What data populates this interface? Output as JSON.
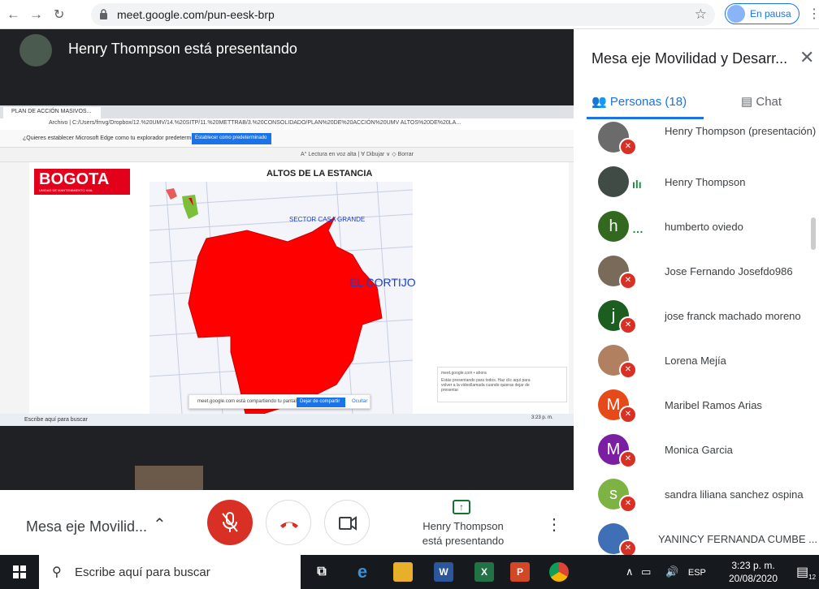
{
  "browser": {
    "url": "meet.google.com/pun-eesk-brp",
    "pause_label": "En pausa"
  },
  "stage": {
    "presenting_title": "Henry Thompson está presentando"
  },
  "screen": {
    "tab_label": "PLAN DE ACCIÓN MASIVOS...",
    "address": "Archivo | C:/Users/fmvg/Dropbox/12.%20UMV/14.%20SITP/11.%20METTRAB/3.%20CONSOLIDADO/PLAN%20DE%20ACCIÓN%20UMV ALTOS%20DE%20LA...",
    "infobar_text": "¿Quieres establecer Microsoft Edge como tu explorador predeterminado?",
    "infobar_button": "Establecer como predeterminado",
    "pdf_tools": "A° Lectura en voz alta   |   ∀ Dibujar  ∨   ◇ Borrar",
    "logo_text": "BOGOTA",
    "logo_sub": "UNIDAD DE MANTENIMIENTO VIAL",
    "map_title": "ALTOS DE LA ESTANCIA",
    "sector_casa": "SECTOR CASA GRANDE",
    "cortijo": "EL CORTIJO",
    "share_text": "meet.google.com está compartiendo tu pantalla.",
    "share_stop": "Dejar de compartir",
    "share_hide": "Ocultar",
    "notif_title": "meet.google.com • ahora",
    "notif_body": "Estás presentando para todos. Haz clic aquí para volver a la videollamada cuando quieras dejar de presentar",
    "taskbar_search": "Escribe aquí para buscar",
    "clock": "3:23 p. m."
  },
  "controls": {
    "meeting_name": "Mesa eje Movilid...",
    "presenting_line1": "Henry Thompson",
    "presenting_line2": "está presentando"
  },
  "panel": {
    "title": "Mesa eje Movilidad y Desarr...",
    "tab_people": "Personas (18)",
    "tab_chat": "Chat",
    "participants": [
      {
        "name": "Henry Thompson (presentación)",
        "initial": "",
        "color": "#6b6b6b",
        "muted": true
      },
      {
        "name": "Henry Thompson",
        "initial": "",
        "color": "#3f4b44",
        "muted": false
      },
      {
        "name": "humberto oviedo",
        "initial": "h",
        "color": "#33691e",
        "muted": false
      },
      {
        "name": "Jose Fernando Josefdo986",
        "initial": "",
        "color": "#7a6a5a",
        "muted": true
      },
      {
        "name": "jose franck machado moreno",
        "initial": "j",
        "color": "#1b5e20",
        "muted": true
      },
      {
        "name": "Lorena Mejía",
        "initial": "",
        "color": "#b08060",
        "muted": true
      },
      {
        "name": "Maribel Ramos Arias",
        "initial": "M",
        "color": "#e64a19",
        "muted": true
      },
      {
        "name": "Monica Garcia",
        "initial": "M",
        "color": "#7b1fa2",
        "muted": true
      },
      {
        "name": "sandra liliana sanchez ospina",
        "initial": "s",
        "color": "#7cb342",
        "muted": true
      },
      {
        "name": "YANINCY FERNANDA CUMBE ...",
        "initial": "",
        "color": "#3f6fb5",
        "muted": true
      }
    ]
  },
  "taskbar": {
    "search_placeholder": "Escribe aquí para buscar",
    "lang": "ESP",
    "time": "3:23 p. m.",
    "date": "20/08/2020",
    "notif_count": "12"
  }
}
